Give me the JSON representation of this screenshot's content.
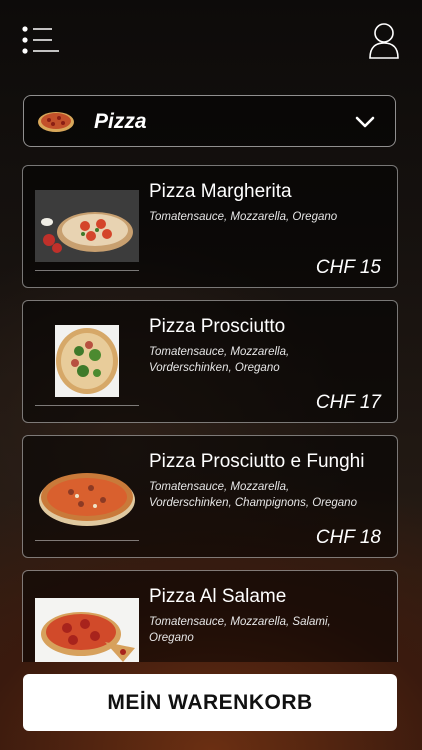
{
  "header": {
    "menu_icon": "menu-list-icon",
    "user_icon": "user-profile-icon"
  },
  "category_selector": {
    "label": "Pizza",
    "icon": "chevron-down-icon"
  },
  "products": [
    {
      "name": "Pizza Margherita",
      "description": "Tomatensauce, Mozzarella, Oregano",
      "price": "CHF 15"
    },
    {
      "name": "Pizza Prosciutto",
      "description": "Tomatensauce, Mozzarella, Vorderschinken, Oregano",
      "price": "CHF 17"
    },
    {
      "name": "Pizza Prosciutto e Funghi",
      "description": "Tomatensauce, Mozzarella, Vorderschinken, Champignons, Oregano",
      "price": "CHF 18"
    },
    {
      "name": "Pizza Al Salame",
      "description": "Tomatensauce, Mozzarella, Salami, Oregano",
      "price": ""
    }
  ],
  "cart_button": {
    "label": "MEİN WARENKORB"
  },
  "colors": {
    "button_bg": "#ffffff",
    "text": "#ffffff",
    "card_border": "#bfbfbf"
  }
}
